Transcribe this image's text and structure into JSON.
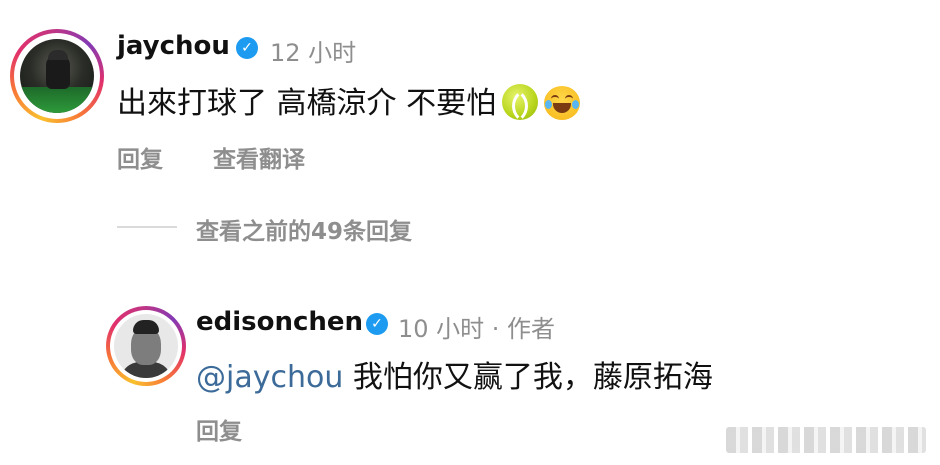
{
  "comment": {
    "username": "jaychou",
    "time": "12 小时",
    "text": "出來打球了 高橋涼介 不要怕",
    "emojis": [
      "tennis-ball-icon",
      "laughing-tears-icon"
    ],
    "actions": {
      "reply": "回复",
      "translate": "查看翻译"
    }
  },
  "view_previous": {
    "label": "查看之前的49条回复"
  },
  "reply": {
    "username": "edisonchen",
    "time": "10 小时 · 作者",
    "mention": "@jaychou",
    "text": "我怕你又赢了我，藤原拓海",
    "actions": {
      "reply": "回复"
    }
  },
  "colors": {
    "verified": "#1d9bf0",
    "mention": "#3d6b99",
    "meta": "#8e8e8e"
  }
}
